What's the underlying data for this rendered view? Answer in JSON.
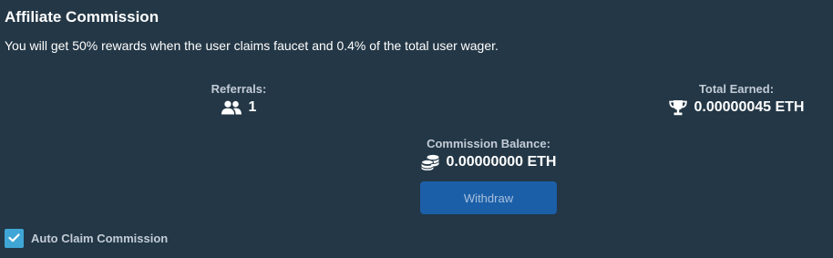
{
  "affiliate": {
    "title": "Affiliate Commission",
    "description": "You will get 50% rewards when the user claims faucet and 0.4% of the total user wager."
  },
  "referrals": {
    "label": "Referrals:",
    "value": "1",
    "icon": "users-icon"
  },
  "total_earned": {
    "label": "Total Earned:",
    "value": "0.00000045 ETH",
    "icon": "trophy-icon"
  },
  "commission_balance": {
    "label": "Commission Balance:",
    "value": "0.00000000 ETH",
    "icon": "coins-icon"
  },
  "withdraw_button": {
    "label": "Withdraw"
  },
  "auto_claim": {
    "label": "Auto Claim Commission",
    "checked": true
  },
  "colors": {
    "background": "#233746",
    "button": "#1b5fa8",
    "checkbox": "#3fa6d6",
    "label": "#c3ccd6"
  }
}
